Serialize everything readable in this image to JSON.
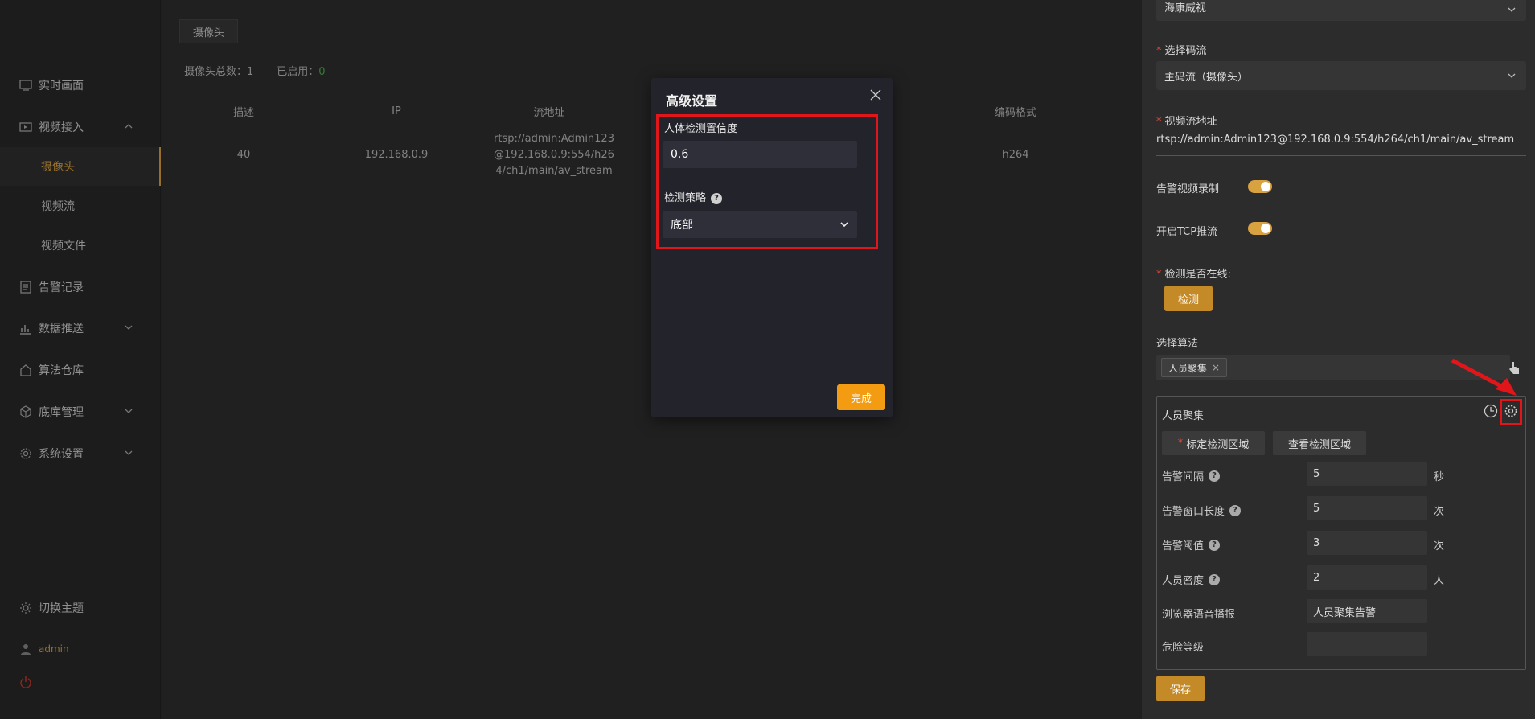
{
  "sidebar": {
    "items": [
      {
        "label": "实时画面",
        "icon": "monitor-icon"
      },
      {
        "label": "视频接入",
        "icon": "video-icon"
      },
      {
        "label": "告警记录",
        "icon": "alarm-record-icon"
      },
      {
        "label": "数据推送",
        "icon": "chart-icon"
      },
      {
        "label": "算法仓库",
        "icon": "warehouse-icon"
      },
      {
        "label": "底库管理",
        "icon": "cube-icon"
      },
      {
        "label": "系统设置",
        "icon": "gear-icon"
      }
    ],
    "sub_items": [
      "摄像头",
      "视频流",
      "视频文件"
    ],
    "theme_label": "切换主题",
    "user": "admin"
  },
  "main": {
    "tab": "摄像头",
    "stats": {
      "total_label": "摄像头总数：",
      "total": "1",
      "enabled_label": "已启用：",
      "enabled": "0"
    },
    "columns": [
      "描述",
      "IP",
      "流地址",
      "编码格式"
    ],
    "row": {
      "desc": "40",
      "ip": "192.168.0.9",
      "stream": "rtsp://admin:Admin123@192.168.0.9:554/h264/ch1/main/av_stream",
      "codec": "h264"
    }
  },
  "dialog": {
    "title": "高级设置",
    "confidence_label": "人体检测置信度",
    "confidence_value": "0.6",
    "strategy_label": "检测策略",
    "strategy_value": "底部",
    "ok_label": "完成"
  },
  "drawer": {
    "brand_value": "海康威视",
    "stream_label": "选择码流",
    "stream_value": "主码流（摄像头）",
    "url_label": "视频流地址",
    "url_value": "rtsp://admin:Admin123@192.168.0.9:554/h264/ch1/main/av_stream",
    "record_label": "告警视频录制",
    "tcp_label": "开启TCP推流",
    "online_label": "检测是否在线:",
    "check_button": "检测",
    "algo_label": "选择算法",
    "algo_tag": "人员聚集",
    "algo_box_title": "人员聚集",
    "mark_region": "标定检测区域",
    "view_region": "查看检测区域",
    "params": [
      {
        "label": "告警间隔",
        "value": "5",
        "unit": "秒",
        "help": true
      },
      {
        "label": "告警窗口长度",
        "value": "5",
        "unit": "次",
        "help": true
      },
      {
        "label": "告警阈值",
        "value": "3",
        "unit": "次",
        "help": true
      },
      {
        "label": "人员密度",
        "value": "2",
        "unit": "人",
        "help": true
      },
      {
        "label": "浏览器语音播报",
        "value": "人员聚集告警",
        "unit": "",
        "help": false
      },
      {
        "label": "危险等级",
        "value": "",
        "unit": "",
        "help": false
      }
    ],
    "save_label": "保存"
  },
  "colors": {
    "accent": "#d8a240",
    "highlight": "#e0161b",
    "ok_button": "#f39c12"
  }
}
